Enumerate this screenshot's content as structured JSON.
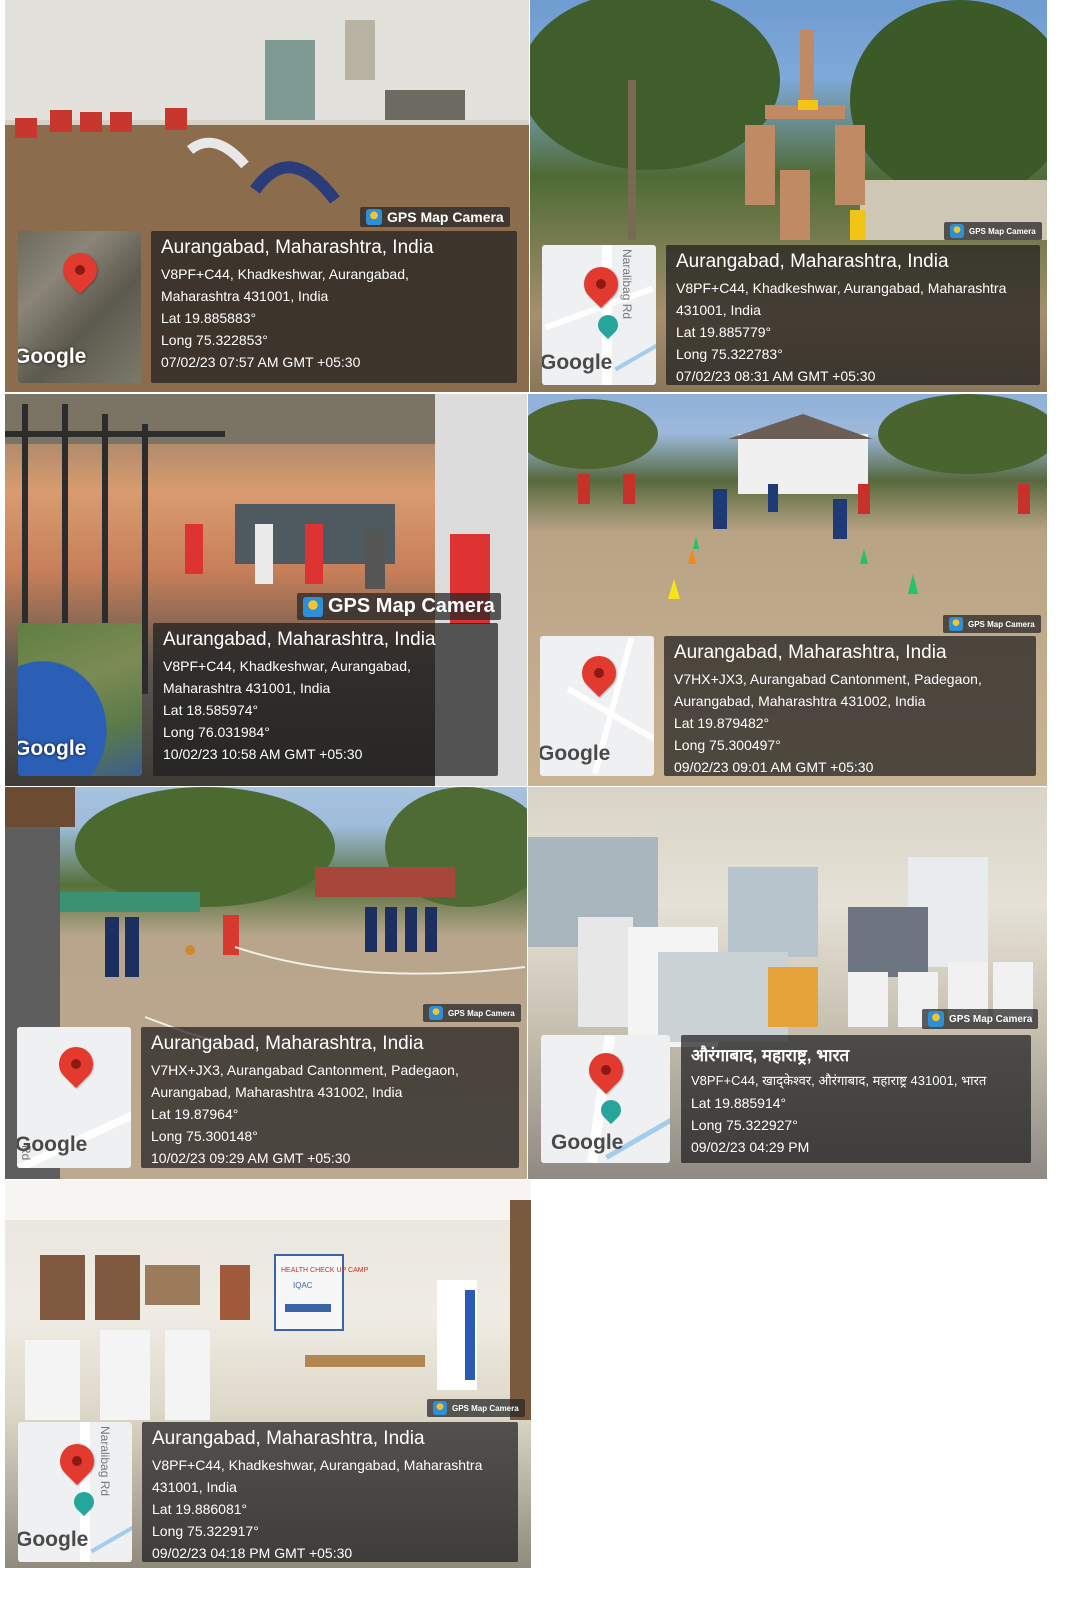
{
  "photos": [
    {
      "badge": "GPS Map Camera",
      "title": "Aurangabad, Maharashtra, India",
      "lines": [
        "V8PF+C44, Khadkeshwar, Aurangabad,",
        "Maharashtra 431001, India",
        "Lat 19.885883°",
        "Long 75.322853°",
        "07/02/23 07:57 AM GMT +05:30"
      ],
      "google": "Google"
    },
    {
      "badge": "GPS Map Camera",
      "title": "Aurangabad, Maharashtra, India",
      "lines": [
        "V8PF+C44, Khadkeshwar, Aurangabad, Maharashtra",
        "431001, India",
        "Lat 19.885779°",
        "Long 75.322783°",
        "07/02/23 08:31 AM GMT +05:30"
      ],
      "google": "Google",
      "road": "Naralibag Rd"
    },
    {
      "badge": "GPS Map Camera",
      "title": "Aurangabad, Maharashtra, India",
      "lines": [
        "V8PF+C44, Khadkeshwar, Aurangabad,",
        "Maharashtra 431001, India",
        "Lat 18.585974°",
        "Long 76.031984°",
        "10/02/23 10:58 AM GMT +05:30"
      ],
      "google": "Google"
    },
    {
      "badge": "GPS Map Camera",
      "title": "Aurangabad, Maharashtra, India",
      "lines": [
        "V7HX+JX3, Aurangabad Cantonment, Padegaon,",
        "Aurangabad, Maharashtra 431002, India",
        "Lat 19.879482°",
        "Long 75.300497°",
        "09/02/23 09:01 AM GMT +05:30"
      ],
      "google": "Google"
    },
    {
      "badge": "GPS Map Camera",
      "title": "Aurangabad, Maharashtra, India",
      "lines": [
        "V7HX+JX3, Aurangabad Cantonment, Padegaon,",
        "Aurangabad, Maharashtra 431002, India",
        "Lat 19.87964°",
        "Long 75.300148°",
        "10/02/23 09:29 AM GMT +05:30"
      ],
      "google": "Google",
      "road": "Rd"
    },
    {
      "badge": "GPS Map Camera",
      "title": "औरंगाबाद, महाराष्ट्र, भारत",
      "lines": [
        "V8PF+C44, खाद्केश्वर, औरंगाबाद, महाराष्ट्र 431001, भारत",
        "Lat 19.885914°",
        "Long 75.322927°",
        "09/02/23 04:29 PM"
      ],
      "google": "Google"
    },
    {
      "badge": "GPS Map Camera",
      "title": "Aurangabad, Maharashtra, India",
      "lines": [
        "V8PF+C44, Khadkeshwar, Aurangabad, Maharashtra",
        "431001, India",
        "Lat 19.886081°",
        "Long 75.322917°",
        "09/02/23 04:18 PM GMT +05:30"
      ],
      "google": "Google",
      "road": "Naralibag Rd",
      "poster": "HEALTH CHECK UP CAMP",
      "poster_sub": "IQAC"
    }
  ]
}
